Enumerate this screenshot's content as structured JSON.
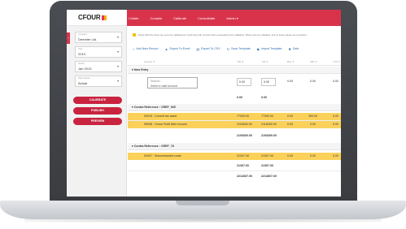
{
  "app": {
    "logo": "CFOUR"
  },
  "nav": [
    "Collate",
    "Compile",
    "Calibrate",
    "Consolidate",
    "Admin ▾"
  ],
  "sidebar": {
    "fields": [
      {
        "label": "Company",
        "value": "Demeter Ltd."
      },
      {
        "label": "Year",
        "value": "2013"
      },
      {
        "label": "Period",
        "value": "Jan 2013"
      },
      {
        "label": "Data Version",
        "value": "Actual"
      }
    ],
    "buttons": [
      "CALIBRATE",
      "PUBLISH",
      "PREVIEW"
    ]
  },
  "notice": "Rows with this colour are yet to be validated for conformity with records when proceeding since validation. While rows are validated, and so these values are consistent.",
  "toolbar": [
    {
      "icon": "+",
      "label": "Add New Record"
    },
    {
      "icon": "▲",
      "label": "Export To Excel"
    },
    {
      "icon": "▤",
      "label": "Export To CSV"
    },
    {
      "icon": "↻",
      "label": "Save Template"
    },
    {
      "icon": "◆",
      "label": "Import Template"
    },
    {
      "icon": "✖",
      "label": "Dele"
    }
  ],
  "table": {
    "headers": [
      "Account ▼",
      "DR ▼",
      "CR ▼",
      "BAL ▼",
      "VAR ▼",
      "YTD ▼"
    ],
    "new_entry": {
      "title": "New Entry",
      "search_placeholder": "Search...",
      "hint": "Select a valid account",
      "values": [
        "0.00",
        "0.00",
        "0.00",
        "0.00",
        "0.00"
      ],
      "totals": [
        "0.00",
        "0.00"
      ]
    },
    "groups": [
      {
        "title": "Contra Reference : CREF_065",
        "rows": [
          {
            "account": "00018 : Current tax asset",
            "cells": [
              "77000.00",
              "77300.00",
              "0.00",
              "300.00",
              "0.00"
            ]
          },
          {
            "account": "99998 : Gross Profit After Income",
            "cells": [
              "2116000.00",
              "2116000.00",
              "0.00",
              "0.00",
              "0.00"
            ]
          }
        ],
        "totals": [
          "2193600.00",
          "2193300.00"
        ]
      },
      {
        "title": "Contra Reference : CREF_78",
        "rows": [
          {
            "account": "02007 : Subcontracted costs",
            "cells": [
              "21307.00",
              "21307.00",
              "0.00",
              "0.00",
              "0.00"
            ]
          }
        ],
        "totals": [
          "21307.00",
          "21307.00"
        ]
      }
    ],
    "grand_totals": [
      "2214307.00",
      "2214607.00"
    ]
  },
  "colors": {
    "brand": "#d9334c",
    "highlight": "#fbd15a",
    "link": "#2b6cb0"
  }
}
